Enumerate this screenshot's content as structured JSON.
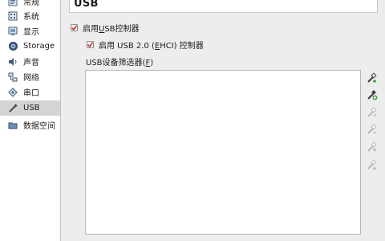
{
  "sidebar": {
    "items": [
      {
        "label": "常规",
        "icon": "general-icon"
      },
      {
        "label": "系统",
        "icon": "system-icon"
      },
      {
        "label": "显示",
        "icon": "display-icon"
      },
      {
        "label": "Storage",
        "icon": "storage-icon"
      },
      {
        "label": "声音",
        "icon": "audio-icon"
      },
      {
        "label": "网络",
        "icon": "network-icon"
      },
      {
        "label": "串口",
        "icon": "serial-port-icon"
      },
      {
        "label": "USB",
        "icon": "usb-icon",
        "selected": true
      },
      {
        "label": "数据空间",
        "icon": "shared-folders-icon"
      }
    ]
  },
  "header": {
    "title": "USB"
  },
  "usb": {
    "enable_usb": {
      "pre": "启用",
      "key": "U",
      "post": "SB控制器",
      "checked": true
    },
    "enable_ehci": {
      "pre": "启用 USB 2.0 (",
      "key": "E",
      "post": "HCI) 控制器",
      "checked": true
    },
    "filters_label": {
      "pre": "USB设备筛选器(",
      "key": "F",
      "post": ")"
    }
  },
  "toolbar": {
    "buttons": [
      {
        "icon": "add-empty-filter-icon",
        "enabled": true
      },
      {
        "icon": "add-filter-from-device-icon",
        "enabled": true
      },
      {
        "icon": "edit-filter-icon",
        "enabled": false
      },
      {
        "icon": "remove-filter-icon",
        "enabled": false
      },
      {
        "icon": "move-filter-up-icon",
        "enabled": false
      },
      {
        "icon": "move-filter-down-icon",
        "enabled": false
      }
    ]
  },
  "colors": {
    "accent": "#c8312b",
    "selection": "#d4d4d4",
    "usb_green": "#3a9a3a"
  }
}
